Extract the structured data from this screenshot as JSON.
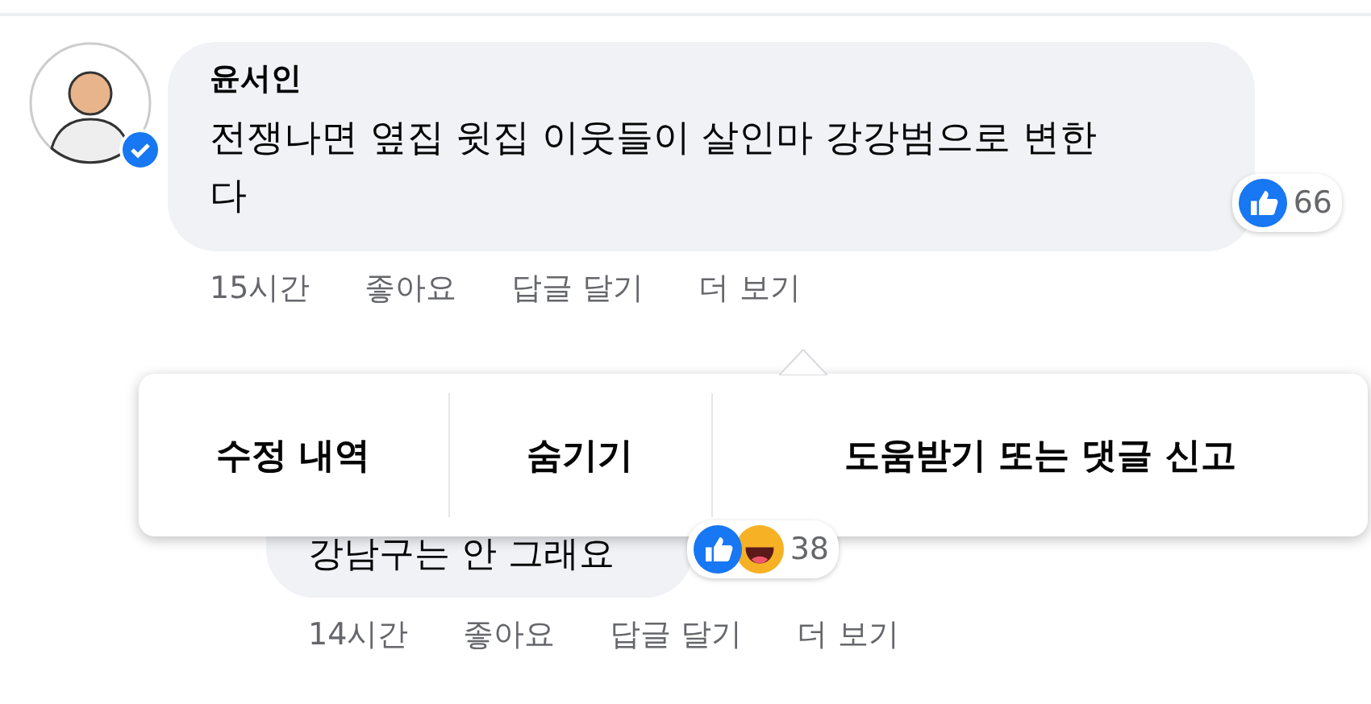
{
  "comment": {
    "author": "윤서인",
    "verified": true,
    "text": "전쟁나면 옆집 윗집 이웃들이 살인마 강강범으로 변한다",
    "reactions": [
      {
        "kind": "like"
      }
    ],
    "reaction_count": "66",
    "actions": [
      "15시간",
      "좋아요",
      "답글 달기",
      "더 보기"
    ]
  },
  "reply": {
    "text": "강남구는 안 그래요",
    "reactions": [
      {
        "kind": "like"
      },
      {
        "kind": "haha"
      }
    ],
    "reaction_count": "38",
    "actions": [
      "14시간",
      "좋아요",
      "답글 달기",
      "더 보기"
    ]
  },
  "menu": {
    "items": [
      "수정 내역",
      "숨기기",
      "도움받기 또는 댓글 신고"
    ]
  }
}
